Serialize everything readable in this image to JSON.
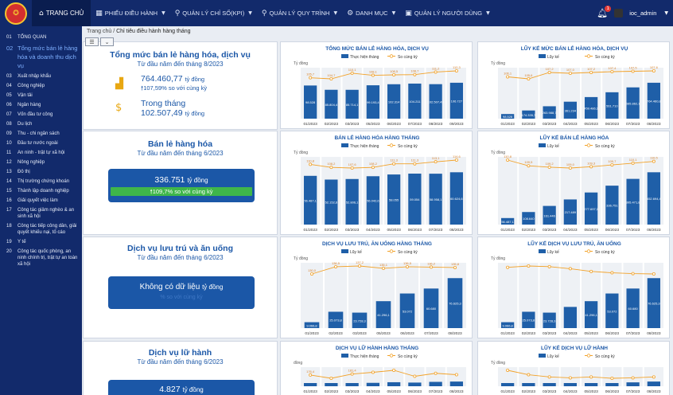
{
  "topbar": {
    "home_label": "TRANG CHỦ",
    "menu": [
      {
        "label": "PHIẾU ĐIỀU HÀNH",
        "icon": "grid-icon"
      },
      {
        "label": "QUẢN LÝ CHỈ SỐ(KPI)",
        "icon": "hierarchy-icon"
      },
      {
        "label": "QUẢN LÝ QUY TRÌNH",
        "icon": "hierarchy-icon"
      },
      {
        "label": "DANH MỤC",
        "icon": "gear-icon"
      },
      {
        "label": "QUẢN LÝ NGƯỜI DÙNG",
        "icon": "user-card-icon"
      }
    ],
    "notif_count": "1",
    "username": "ioc_admin"
  },
  "sidebar": [
    {
      "num": "01",
      "label": "TỔNG QUAN"
    },
    {
      "num": "02",
      "label": "Tổng mức bán lẻ hàng hóa và doanh thu dịch vụ",
      "active": true
    },
    {
      "num": "03",
      "label": "Xuất nhập khẩu"
    },
    {
      "num": "04",
      "label": "Công nghiệp"
    },
    {
      "num": "05",
      "label": "Vận tải"
    },
    {
      "num": "06",
      "label": "Ngân hàng"
    },
    {
      "num": "07",
      "label": "Vốn đầu tư công"
    },
    {
      "num": "08",
      "label": "Du lịch"
    },
    {
      "num": "09",
      "label": "Thu - chi ngân sách"
    },
    {
      "num": "10",
      "label": "Đầu tư nước ngoài"
    },
    {
      "num": "11",
      "label": "An ninh - trật tự xã hội"
    },
    {
      "num": "12",
      "label": "Nông nghiệp"
    },
    {
      "num": "13",
      "label": "Đô thị"
    },
    {
      "num": "14",
      "label": "Thị trường chứng khoán"
    },
    {
      "num": "15",
      "label": "Thành lập doanh nghiệp"
    },
    {
      "num": "16",
      "label": "Giải quyết việc làm"
    },
    {
      "num": "17",
      "label": "Công tác giảm nghèo & an sinh xã hội"
    },
    {
      "num": "18",
      "label": "Công tác tiếp công dân, giải quyết khiếu nại, tố cáo"
    },
    {
      "num": "19",
      "label": "Y tế"
    },
    {
      "num": "20",
      "label": "Công tác quốc phòng, an ninh chính trị, trật tự an toàn xã hội"
    }
  ],
  "breadcrumb": {
    "home": "Trang chủ",
    "separator": "/",
    "current": "Chỉ tiêu điều hành hàng tháng"
  },
  "panels": {
    "total": {
      "title": "Tổng mức bán lẻ hàng hóa, dịch vụ",
      "subtitle": "Từ đầu năm đến tháng 8/2023",
      "value": "764.460,77",
      "unit": "tỷ đồng",
      "growth": "107,59% so với cùng kỳ",
      "sub_label": "Trong tháng",
      "sub_value": "102.507,49",
      "sub_unit": "tỷ đồng"
    },
    "retail": {
      "title": "Bán lẻ hàng hóa",
      "subtitle": "Từ đầu năm đến tháng 6/2023",
      "value": "336.751",
      "unit": "tỷ đồng",
      "growth": "109,7% so với cùng kỳ"
    },
    "accommodation": {
      "title": "Dịch vụ lưu trú và ăn uống",
      "subtitle": "Từ đầu năm đến tháng 6/2023",
      "no_data": "Không có dữ liệu",
      "unit": "tỷ đồng",
      "growth_faded": "% so với cùng kỳ"
    },
    "travel": {
      "title": "Dịch vụ lữ hành",
      "subtitle": "Từ đầu năm đến tháng 6/2023",
      "value": "4.827",
      "unit": "tỷ đồng"
    }
  },
  "colors": {
    "bar": "#1f5fa8",
    "line": "#f2a229",
    "accent": "#1b57a7",
    "green": "#3fb64a",
    "nav": "#122a6b"
  },
  "chart_data": [
    {
      "type": "bar",
      "title": "TỔNG MỨC BÁN LẺ HÀNG HÓA, DỊCH VỤ",
      "ylabel": "Tỷ đồng",
      "legend": [
        "Thực hiện tháng",
        "So cùng kỳ"
      ],
      "categories": [
        "01/2023",
        "02/2023",
        "03/2023",
        "05/2023",
        "06/2023",
        "07/2023",
        "08/2023",
        "09/2023"
      ],
      "values": [
        98528,
        85804,
        85714,
        99193,
        102314,
        104211,
        102507,
        106727
      ],
      "value_labels": [
        "98.528",
        "85.804,4",
        "85.714,1",
        "99.193,4",
        "102.314",
        "104.211",
        "102.507,49",
        "106.727"
      ],
      "line": [
        105.7,
        104.7,
        110.1,
        108.1,
        108.5,
        108.7,
        111.2,
        112.3
      ],
      "line_labels": [
        "105,7",
        "104,7",
        "110,1",
        "108,1",
        "108,5",
        "108,7",
        "111,2",
        "112,3"
      ]
    },
    {
      "type": "bar",
      "title": "LŨY KẾ MỨC BÁN LẺ HÀNG HÓA, DỊCH VỤ",
      "ylabel": "Tỷ đồng",
      "legend": [
        "Lũy kế",
        "So cùng kỳ"
      ],
      "categories": [
        "01/2023",
        "02/2023",
        "03/2023",
        "04/2023",
        "05/2023",
        "06/2023",
        "07/2023",
        "08/2023"
      ],
      "values": [
        98528,
        174335,
        263988,
        361234,
        459486,
        561710,
        665862,
        764461
      ],
      "value_labels": [
        "98.528",
        "174.335,7",
        "263.988,7",
        "361.234",
        "459.486,1",
        "561.710",
        "665.862,1",
        "764.460,8"
      ],
      "line": [
        106.1,
        105.6,
        107.2,
        107.0,
        107.2,
        107.4,
        107.5,
        107.6
      ],
      "line_labels": [
        "106,1",
        "105,6",
        "107,2",
        "107,0",
        "107,2",
        "107,4",
        "107,5",
        "107,6"
      ]
    },
    {
      "type": "bar",
      "title": "BÁN LẺ HÀNG HÓA HÀNG THÁNG",
      "ylabel": "Tỷ đồng",
      "legend": [
        "Thực hiện tháng",
        "So cùng kỳ"
      ],
      "categories": [
        "01/2023",
        "02/2023",
        "03/2023",
        "04/2023",
        "05/2023",
        "06/2023",
        "07/2023",
        "08/2023"
      ],
      "values": [
        56487,
        52153,
        52806,
        56042,
        58055,
        59054,
        58958,
        60624
      ],
      "value_labels": [
        "56.487,1",
        "52.152,6",
        "52.806,1",
        "56.042,6",
        "58.055",
        "59.054",
        "58.958,1",
        "60.624,6"
      ],
      "line": [
        110.8,
        108.2,
        107.6,
        108.2,
        111.3,
        111.3,
        113.1,
        114.6
      ],
      "line_labels": [
        "110,8",
        "108,2",
        "107,6",
        "108,2",
        "111,3",
        "111,3",
        "113,1",
        "114,6"
      ]
    },
    {
      "type": "bar",
      "title": "LŨY KẾ BÁN LẺ HÀNG HÓA",
      "ylabel": "Tỷ đồng",
      "legend": [
        "Lũy kế",
        "So cùng kỳ"
      ],
      "categories": [
        "01/2023",
        "02/2023",
        "03/2023",
        "04/2023",
        "05/2023",
        "06/2023",
        "07/2023",
        "08/2023"
      ],
      "values": [
        56487,
        108640,
        161446,
        217489,
        277697,
        336751,
        395472,
        452694
      ],
      "value_labels": [
        "56.487,1",
        "108.640",
        "161.446",
        "217.489",
        "277.697,1",
        "336.751",
        "395.471,8",
        "452.694,4"
      ],
      "line": [
        110.8,
        109.5,
        109.2,
        109.0,
        109.3,
        109.7,
        110.1,
        110.5
      ],
      "line_labels": [
        "110,8",
        "109,5",
        "109,2",
        "109,0",
        "109,3",
        "109,7",
        "110,1",
        "110,5"
      ]
    },
    {
      "type": "bar",
      "title": "DỊCH VỤ LƯU TRÚ, ĂN UỐNG HÀNG THÁNG",
      "ylabel": "Tỷ đồng",
      "legend": [
        "Lũy kế",
        "So cùng kỳ"
      ],
      "categories": [
        "01/2023",
        "02/2023",
        "03/2023",
        "05/2023",
        "06/2023",
        "07/2023",
        "08/2023"
      ],
      "values": [
        9066,
        25073,
        23728,
        41296,
        53072,
        60680,
        76625
      ],
      "value_labels": [
        "9.066,8",
        "25.073,8",
        "23.728,3",
        "41.296,1",
        "53.072",
        "60.680",
        "76.625,3"
      ],
      "line": [
        130.0,
        136.5,
        137.2,
        135.1,
        136.5,
        136.2,
        135.8
      ],
      "line_labels": [
        "130,0",
        "136,5",
        "137,2",
        "135,1",
        "136,5",
        "136,2",
        "135,8"
      ]
    },
    {
      "type": "bar",
      "title": "LŨY KẾ DỊCH VỤ LƯU TRÚ, ĂN UỐNG",
      "ylabel": "Tỷ đồng",
      "legend": [
        "Lũy kế",
        "So cùng kỳ"
      ],
      "categories": [
        "01/2023",
        "02/2023",
        "03/2023",
        "04/2023",
        "05/2023",
        "06/2023",
        "07/2023",
        "08/2023"
      ],
      "values": [
        9066,
        25073,
        23728,
        32500,
        41296,
        53072,
        60680,
        76625
      ],
      "value_labels": [
        "9.066,8",
        "25.073,8",
        "23.728,3",
        "",
        "41.296,1",
        "53.072",
        "60.680",
        "76.625,3"
      ],
      "line": [
        140.0,
        142.0,
        141.0,
        138.0,
        134.0,
        132.0,
        130.8,
        130.3
      ],
      "line_labels": [
        "",
        "",
        "",
        "",
        "",
        "",
        "",
        ""
      ]
    },
    {
      "type": "bar",
      "title": "DỊCH VỤ LỮ HÀNH HÀNG THÁNG",
      "ylabel": "đồng",
      "legend": [
        "Thực hiện tháng",
        "So cùng kỳ"
      ],
      "categories": [
        "01/2023",
        "02/2023",
        "03/2023",
        "04/2023",
        "05/2023",
        "06/2023",
        "07/2023",
        "08/2023"
      ],
      "values": [
        400,
        520,
        680,
        760,
        900,
        820,
        980,
        1050
      ],
      "value_labels": [
        "",
        "",
        "",
        "",
        "",
        "",
        "",
        ""
      ],
      "line": [
        176.4,
        160.0,
        181.4,
        190.0,
        200.0,
        170.0,
        185.0,
        178.0
      ],
      "line_labels": [
        "176,4",
        "",
        "181,4",
        "",
        "",
        "",
        "",
        ""
      ]
    },
    {
      "type": "bar",
      "title": "LŨY KẾ DỊCH VỤ LỮ HÀNH",
      "ylabel": "Tỷ đồng",
      "legend": [
        "Lũy kế",
        "So cùng kỳ"
      ],
      "categories": [
        "01/2023",
        "02/2023",
        "03/2023",
        "04/2023",
        "05/2023",
        "06/2023",
        "07/2023",
        "08/2023"
      ],
      "values": [
        400,
        920,
        1600,
        2360,
        3260,
        4080,
        5060,
        6110
      ],
      "value_labels": [
        "",
        "",
        "",
        "",
        "",
        "",
        "",
        ""
      ],
      "line": [
        180.0,
        170.0,
        165.0,
        163.0,
        165.0,
        162.0,
        163.0,
        165.0
      ],
      "line_labels": [
        "",
        "",
        "",
        "",
        "",
        "",
        "",
        ""
      ]
    }
  ]
}
